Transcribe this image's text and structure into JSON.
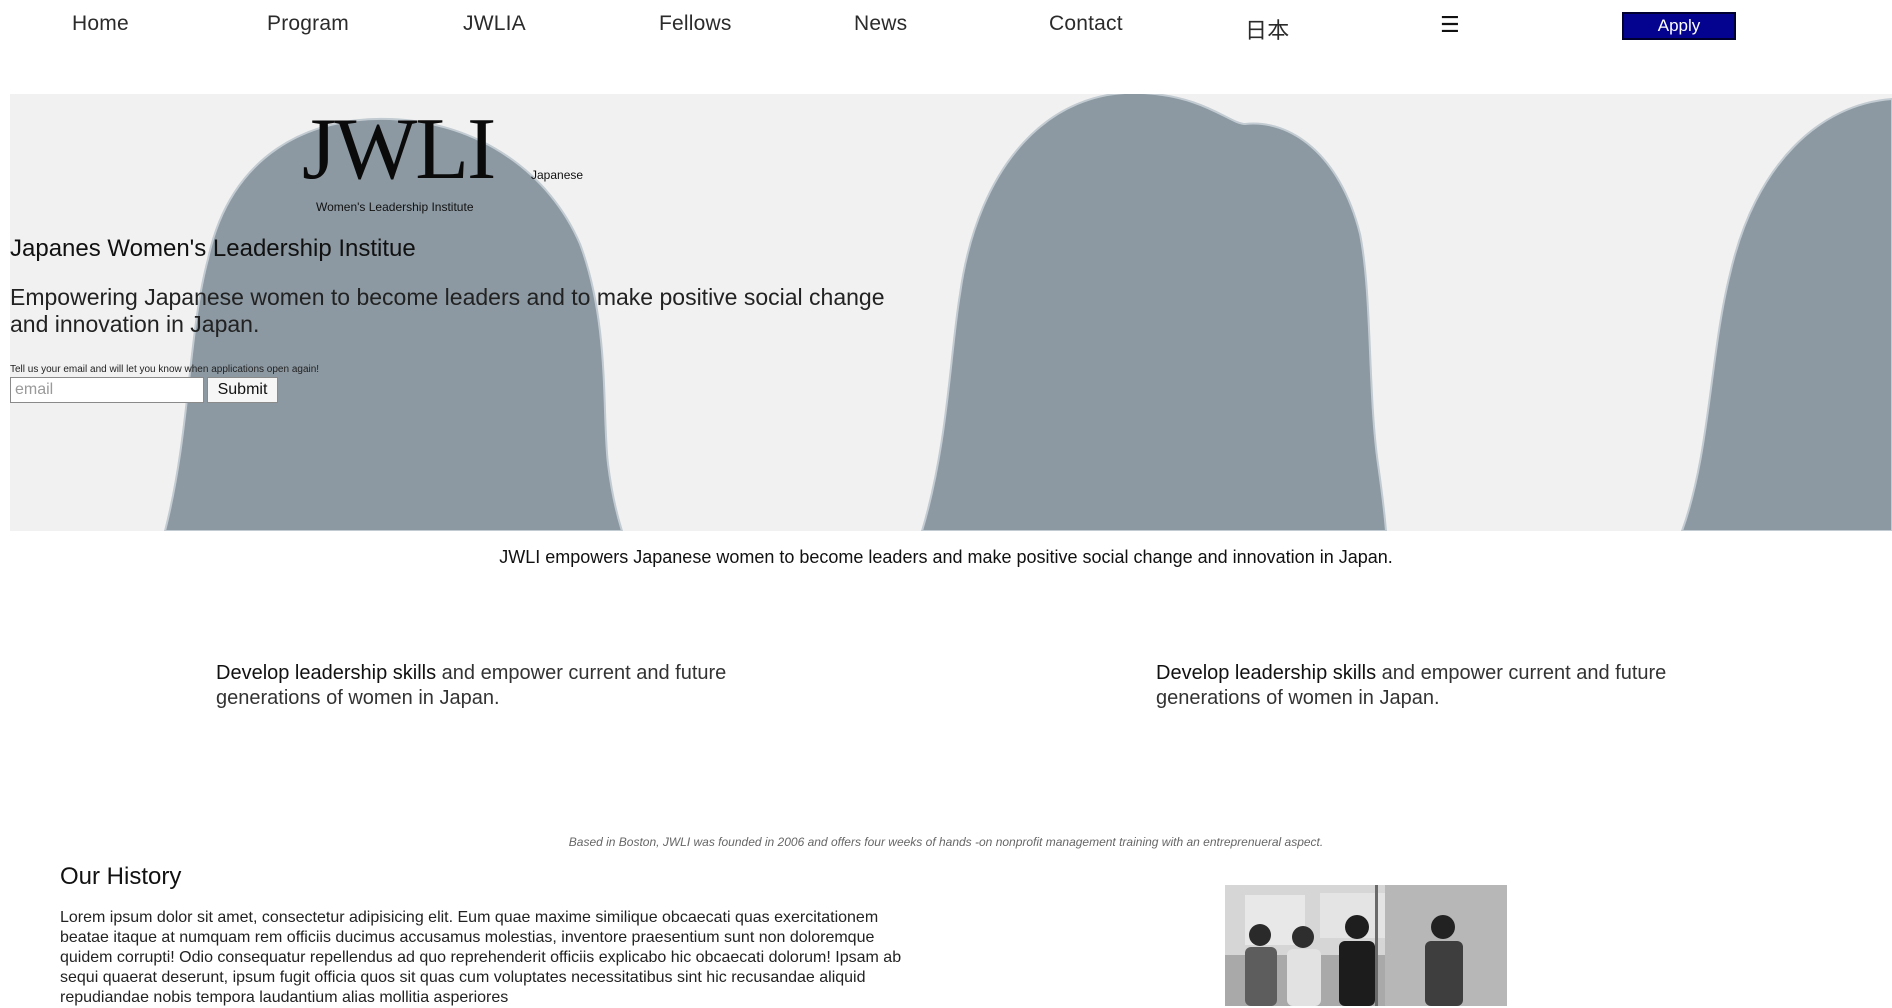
{
  "nav": {
    "links": [
      "Home",
      "Program",
      "JWLIA",
      "Fellows",
      "News",
      "Contact"
    ],
    "lang": "日本",
    "menu_icon": "☰",
    "apply_label": "Apply"
  },
  "hero": {
    "logo_mark": "JWLI",
    "logo_sub1": "Japanese",
    "logo_sub2": "Women's Leadership Institute",
    "title": "Japanes Women's Leadership Institue",
    "description": "Empowering Japanese women to become leaders and to make positive social change and innovation in Japan.",
    "signup_note": "Tell us your email and will let you know when applications open again!",
    "email_placeholder": "email",
    "submit_label": "Submit"
  },
  "mission": "JWLI empowers Japanese women to become leaders and make positive social change and innovation in Japan.",
  "features": [
    {
      "bold": "Develop leadership skills",
      "text": " and empower current and future generations of women in Japan."
    },
    {
      "bold": "Develop leadership skills",
      "text": " and empower current and future generations of women in Japan."
    }
  ],
  "founded": "Based in Boston, JWLI was founded in 2006 and offers four weeks of hands -on nonprofit management training with an entreprenueral aspect.",
  "history": {
    "title": "Our History",
    "body": "Lorem ipsum dolor sit amet, consectetur adipisicing elit. Eum quae maxime similique obcaecati quas exercitationem beatae itaque at numquam rem officiis ducimus accusamus molestias, inventore praesentium sunt non doloremque quidem corrupti! Odio consequatur repellendus ad quo reprehenderit officiis explicabo hic obcaecati dolorum! Ipsam ab sequi quaerat deserunt, ipsum fugit officia quos sit quas cum voluptates necessitatibus sint hic recusandae aliquid repudiandae nobis tempora laudantium alias mollitia asperiores"
  },
  "colors": {
    "apply_bg": "#03038f",
    "hero_bg": "#f1f1f1",
    "silhouette": "#8c99a2"
  },
  "icons": {
    "menu": "hamburger-icon"
  }
}
